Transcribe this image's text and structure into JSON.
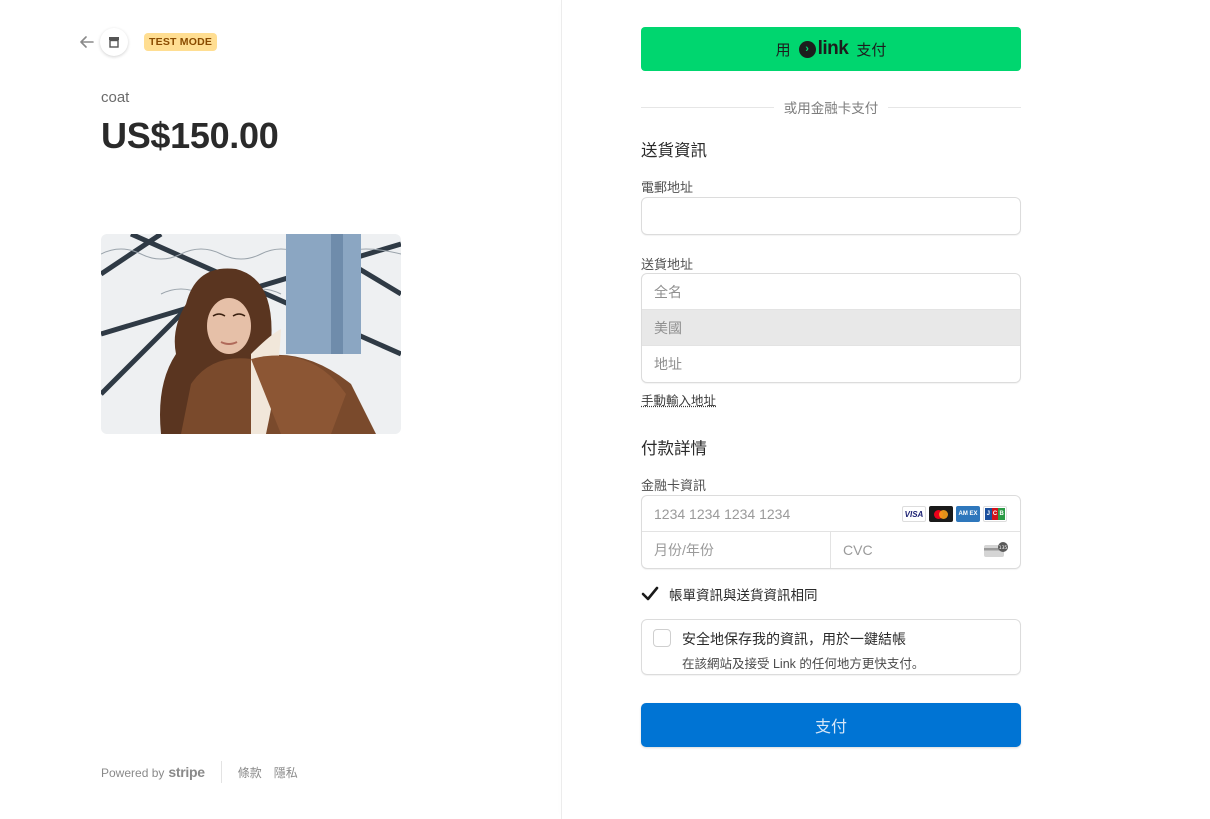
{
  "header": {
    "test_mode": "TEST MODE"
  },
  "product": {
    "name": "coat",
    "price": "US$150.00"
  },
  "footer": {
    "powered_by": "Powered by",
    "brand": "stripe",
    "terms": "條款",
    "privacy": "隱私"
  },
  "link_button": {
    "prefix": "用",
    "logo": "link",
    "suffix": "支付"
  },
  "divider": {
    "text": "或用金融卡支付"
  },
  "shipping": {
    "title": "送貨資訊",
    "email_label": "電郵地址",
    "email_value": "",
    "address_label": "送貨地址",
    "full_name_placeholder": "全名",
    "country": "美國",
    "address_placeholder": "地址",
    "manual_link": "手動輸入地址"
  },
  "payment": {
    "title": "付款詳情",
    "card_label": "金融卡資訊",
    "card_number_placeholder": "1234 1234 1234 1234",
    "expiry_placeholder": "月份/年份",
    "cvc_placeholder": "CVC",
    "brands": [
      "visa-icon",
      "mastercard-icon",
      "amex-icon",
      "jcb-icon"
    ],
    "brand_visa": "VISA",
    "brand_amex": "AM EX",
    "brand_jcb": [
      "J",
      "C",
      "B"
    ],
    "cvc_icon_text": "135"
  },
  "billing_same": {
    "checked": true,
    "label": "帳單資訊與送貨資訊相同"
  },
  "save_info": {
    "checked": false,
    "title": "安全地保存我的資訊，用於一鍵結帳",
    "subtitle": "在該網站及接受 Link 的任何地方更快支付。"
  },
  "pay_button": {
    "label": "支付"
  },
  "colors": {
    "link_green": "#00d66f",
    "pay_blue": "#0074d4",
    "test_mode_bg": "#ffde92"
  }
}
